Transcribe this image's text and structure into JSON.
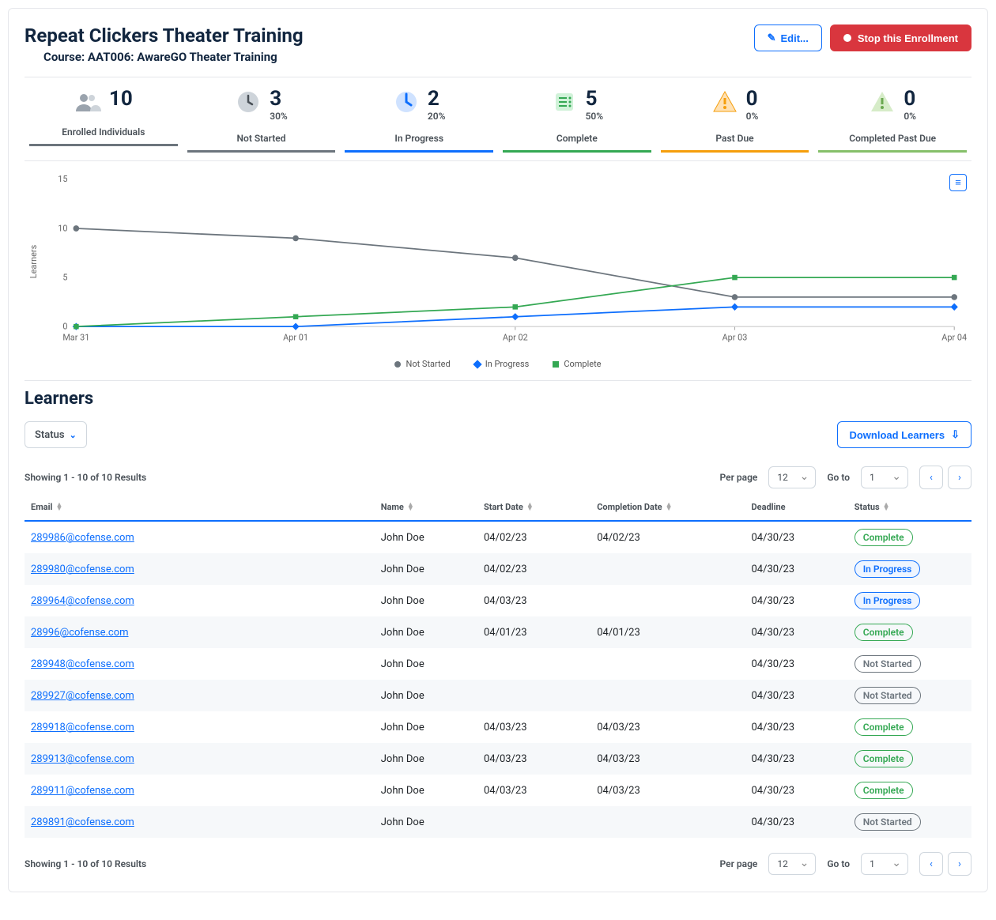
{
  "title": "Repeat Clickers Theater Training",
  "subtitle": "Course: AAT006: AwareGO Theater Training",
  "buttons": {
    "edit": "Edit...",
    "stop": "Stop this Enrollment",
    "download": "Download Learners",
    "status_filter": "Status"
  },
  "stats": [
    {
      "icon": "users",
      "color": "#6c757d",
      "value": "10",
      "pct": "",
      "label": "Enrolled Individuals"
    },
    {
      "icon": "clock",
      "color": "#6c757d",
      "value": "3",
      "pct": "30%",
      "label": "Not Started"
    },
    {
      "icon": "hourglass",
      "color": "#0d6efd",
      "value": "2",
      "pct": "20%",
      "label": "In Progress"
    },
    {
      "icon": "check",
      "color": "#34a853",
      "value": "5",
      "pct": "50%",
      "label": "Complete"
    },
    {
      "icon": "warn",
      "color": "#f59e0b",
      "value": "0",
      "pct": "0%",
      "label": "Past Due"
    },
    {
      "icon": "warn2",
      "color": "#86c06a",
      "value": "0",
      "pct": "0%",
      "label": "Completed Past Due"
    }
  ],
  "chart_data": {
    "type": "line",
    "ylabel": "Learners",
    "ylim": [
      0,
      15
    ],
    "yticks": [
      0,
      5,
      10,
      15
    ],
    "categories": [
      "Mar 31",
      "Apr 01",
      "Apr 02",
      "Apr 03",
      "Apr 04"
    ],
    "series": [
      {
        "name": "Not Started",
        "color": "#6c757d",
        "marker": "circle",
        "values": [
          10,
          9,
          7,
          3,
          3
        ]
      },
      {
        "name": "In Progress",
        "color": "#0d6efd",
        "marker": "diamond",
        "values": [
          0,
          0,
          1,
          2,
          2
        ]
      },
      {
        "name": "Complete",
        "color": "#34a853",
        "marker": "square",
        "values": [
          0,
          1,
          2,
          5,
          5
        ]
      }
    ]
  },
  "learners_title": "Learners",
  "pager": {
    "showing": "Showing 1 - 10 of 10 Results",
    "per_page": "Per page",
    "per_page_val": "12",
    "goto": "Go to",
    "goto_val": "1"
  },
  "columns": {
    "email": "Email",
    "name": "Name",
    "start": "Start Date",
    "completion": "Completion Date",
    "deadline": "Deadline",
    "status": "Status"
  },
  "rows": [
    {
      "email": "289986@cofense.com",
      "name": "John Doe",
      "start": "04/02/23",
      "completion": "04/02/23",
      "deadline": "04/30/23",
      "status": "Complete"
    },
    {
      "email": "289980@cofense.com",
      "name": "John Doe",
      "start": "04/02/23",
      "completion": "",
      "deadline": "04/30/23",
      "status": "In Progress"
    },
    {
      "email": "289964@cofense.com",
      "name": "John Doe",
      "start": "04/03/23",
      "completion": "",
      "deadline": "04/30/23",
      "status": "In Progress"
    },
    {
      "email": "28996@cofense.com",
      "name": "John Doe",
      "start": "04/01/23",
      "completion": "04/01/23",
      "deadline": "04/30/23",
      "status": "Complete"
    },
    {
      "email": "289948@cofense.com",
      "name": "John Doe",
      "start": "",
      "completion": "",
      "deadline": "04/30/23",
      "status": "Not Started"
    },
    {
      "email": "289927@cofense.com",
      "name": "John Doe",
      "start": "",
      "completion": "",
      "deadline": "04/30/23",
      "status": "Not Started"
    },
    {
      "email": "289918@cofense.com",
      "name": "John Doe",
      "start": "04/03/23",
      "completion": "04/03/23",
      "deadline": "04/30/23",
      "status": "Complete"
    },
    {
      "email": "289913@cofense.com",
      "name": "John Doe",
      "start": "04/03/23",
      "completion": "04/03/23",
      "deadline": "04/30/23",
      "status": "Complete"
    },
    {
      "email": "289911@cofense.com",
      "name": "John Doe",
      "start": "04/03/23",
      "completion": "04/03/23",
      "deadline": "04/30/23",
      "status": "Complete"
    },
    {
      "email": "289891@cofense.com",
      "name": "John Doe",
      "start": "",
      "completion": "",
      "deadline": "04/30/23",
      "status": "Not Started"
    }
  ]
}
